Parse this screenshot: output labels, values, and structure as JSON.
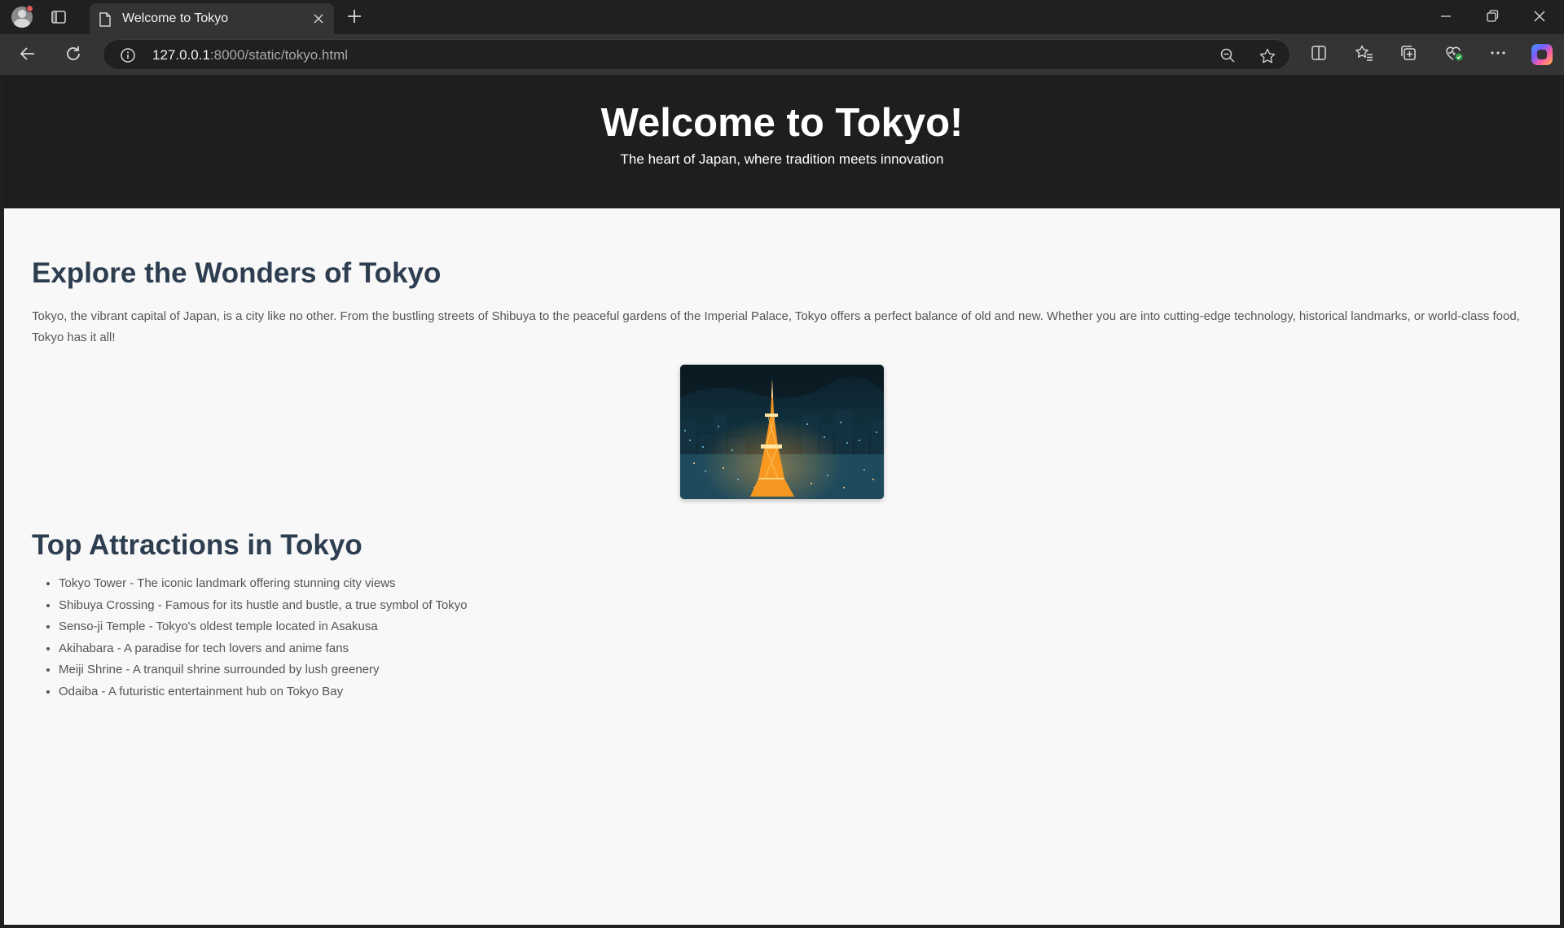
{
  "browser": {
    "tab_title": "Welcome to Tokyo",
    "url_host": "127.0.0.1",
    "url_rest": ":8000/static/tokyo.html",
    "icons": [
      "profile-icon",
      "sidebar-icon",
      "page-icon",
      "close-icon",
      "plus-icon",
      "minimize-icon",
      "restore-icon",
      "back-icon",
      "reload-icon",
      "info-icon",
      "zoom-out-icon",
      "star-icon",
      "split-screen-icon",
      "favorites-icon",
      "collections-icon",
      "browser-essentials-icon",
      "more-icon",
      "copilot-icon"
    ]
  },
  "page": {
    "hero_title": "Welcome to Tokyo!",
    "hero_subtitle": "The heart of Japan, where tradition meets innovation",
    "section1_title": "Explore the Wonders of Tokyo",
    "intro": "Tokyo, the vibrant capital of Japan, is a city like no other. From the bustling streets of Shibuya to the peaceful gardens of the Imperial Palace, Tokyo offers a perfect balance of old and new. Whether you are into cutting-edge technology, historical landmarks, or world-class food, Tokyo has it all!",
    "section2_title": "Top Attractions in Tokyo",
    "attractions": [
      "Tokyo Tower - The iconic landmark offering stunning city views",
      "Shibuya Crossing - Famous for its hustle and bustle, a true symbol of Tokyo",
      "Senso-ji Temple - Tokyo's oldest temple located in Asakusa",
      "Akihabara - A paradise for tech lovers and anime fans",
      "Meiji Shrine - A tranquil shrine surrounded by lush greenery",
      "Odaiba - A futuristic entertainment hub on Tokyo Bay"
    ]
  },
  "colors": {
    "hero_bg": "#1e1e1e",
    "heading": "#2d3e50",
    "body_text": "#555555",
    "page_bg": "#f8f8f8"
  }
}
